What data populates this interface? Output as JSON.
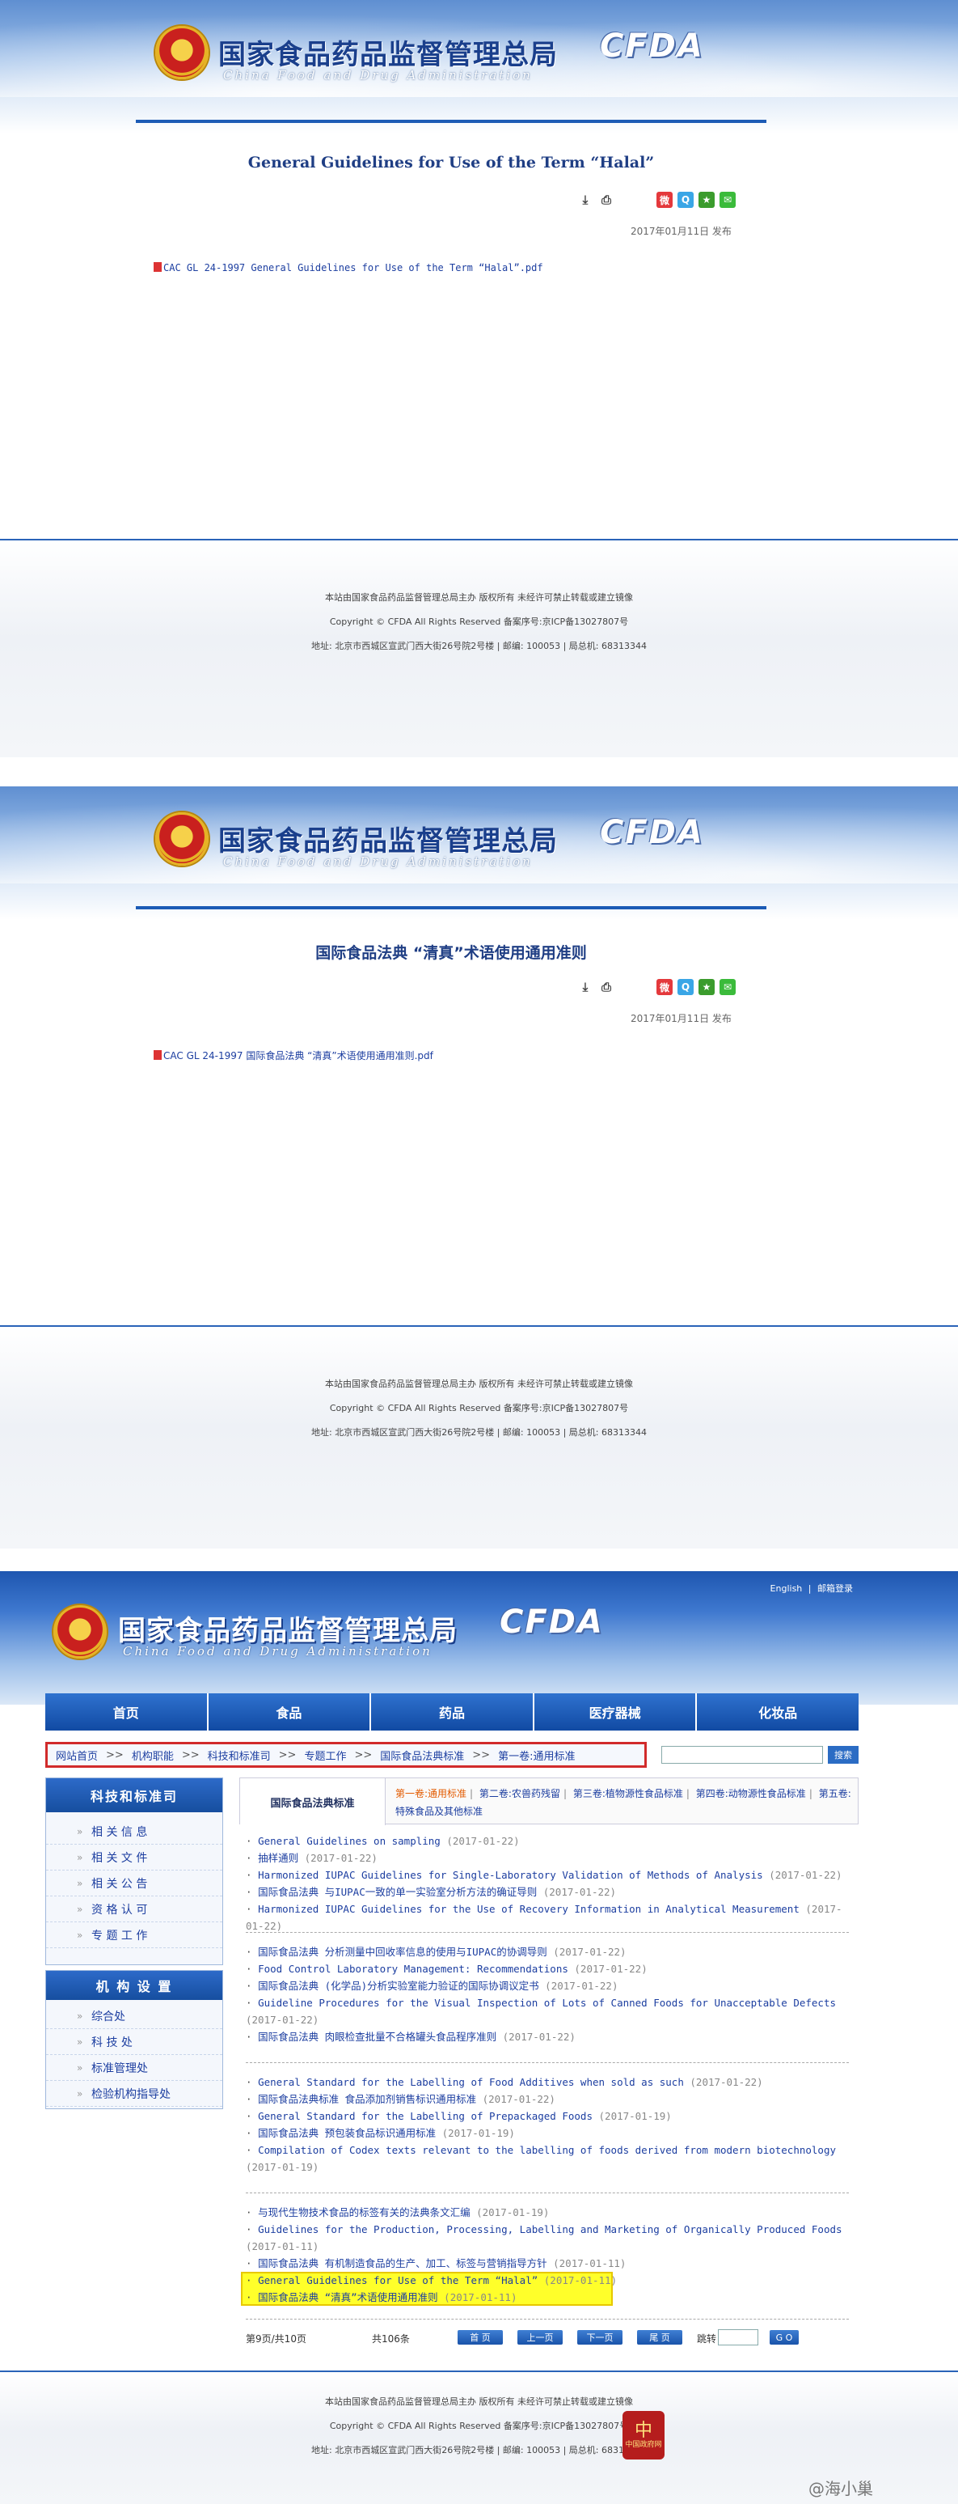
{
  "site": {
    "name_cn": "国家食品药品监督管理总局",
    "name_en": "China Food and Drug Administration",
    "logo_text": "CFDA"
  },
  "articles": [
    {
      "title": "General Guidelines for Use of the Term “Halal”",
      "pub_date": "2017年01月11日 发布",
      "attachment": "CAC GL 24-1997 General Guidelines for Use of the Term “Halal”.pdf"
    },
    {
      "title": "国际食品法典 “清真”术语使用通用准则",
      "pub_date": "2017年01月11日 发布",
      "attachment": "CAC GL 24-1997 国际食品法典 “清真”术语使用通用准则.pdf"
    }
  ],
  "share_icons": [
    "download-icon",
    "print-icon",
    "weibo-icon",
    "qzone-icon",
    "favorite-icon",
    "wechat-icon"
  ],
  "footer": {
    "line1": "本站由国家食品药品监督管理总局主办  版权所有  未经许可禁止转载或建立镜像",
    "line2": "Copyright © CFDA All Rights Reserved  备案序号:京ICP备13027807号",
    "line3": "地址: 北京市西城区宣武门西大街26号院2号楼  |  邮编: 100053  |  局总机: 68313344"
  },
  "top_links": {
    "english": "English",
    "mail": "邮箱登录"
  },
  "nav": [
    "首页",
    "食品",
    "药品",
    "医疗器械",
    "化妆品"
  ],
  "breadcrumb": [
    "网站首页",
    "机构职能",
    "科技和标准司",
    "专题工作",
    "国际食品法典标准",
    "第一卷:通用标准"
  ],
  "breadcrumb_sep": ">>",
  "search": {
    "button": "搜索",
    "placeholder": ""
  },
  "sidebar1": {
    "title": "科技和标准司",
    "items": [
      "相 关 信 息",
      "相 关 文 件",
      "相 关 公 告",
      "资 格 认 可",
      "专 题 工 作"
    ]
  },
  "sidebar2": {
    "title": "机 构 设 置",
    "items": [
      "综合处",
      "科 技 处",
      "标准管理处",
      "检验机构指导处"
    ]
  },
  "tabs": {
    "label": "国际食品法典标准",
    "items": [
      "第一卷:通用标准",
      "第二卷:农兽药残留",
      "第三卷:植物源性食品标准",
      "第四卷:动物源性食品标准",
      "第五卷:特殊食品及其他标准"
    ],
    "active": 0
  },
  "list_groups": [
    [
      {
        "t": "General Guidelines on sampling",
        "d": "(2017-01-22)"
      },
      {
        "t": "抽样通则",
        "d": "(2017-01-22)"
      },
      {
        "t": "Harmonized IUPAC Guidelines for Single-Laboratory Validation of Methods of Analysis",
        "d": "(2017-01-22)"
      },
      {
        "t": "国际食品法典 与IUPAC一致的单一实验室分析方法的确证导则",
        "d": "(2017-01-22)"
      },
      {
        "t": "Harmonized IUPAC Guidelines for the Use of Recovery Information in Analytical Measurement",
        "d": "(2017-01-22)"
      }
    ],
    [
      {
        "t": "国际食品法典 分析测量中回收率信息的使用与IUPAC的协调导则",
        "d": "(2017-01-22)"
      },
      {
        "t": "Food Control Laboratory Management: Recommendations",
        "d": "(2017-01-22)"
      },
      {
        "t": "国际食品法典 (化学品)分析实验室能力验证的国际协调议定书",
        "d": "(2017-01-22)"
      },
      {
        "t": "Guideline Procedures for the Visual Inspection of Lots of Canned Foods for Unacceptable Defects",
        "d": "(2017-01-22)"
      },
      {
        "t": "国际食品法典 肉眼检查批量不合格罐头食品程序准则",
        "d": "(2017-01-22)"
      }
    ],
    [
      {
        "t": "General Standard for the Labelling of Food Additives when sold as such",
        "d": "(2017-01-22)"
      },
      {
        "t": "国际食品法典标准 食品添加剂销售标识通用标准",
        "d": "(2017-01-22)"
      },
      {
        "t": "General Standard for the Labelling of Prepackaged Foods",
        "d": "(2017-01-19)"
      },
      {
        "t": "国际食品法典 预包装食品标识通用标准",
        "d": "(2017-01-19)"
      },
      {
        "t": "Compilation of Codex texts relevant to the labelling of foods derived from modern biotechnology",
        "d": "(2017-01-19)"
      }
    ],
    [
      {
        "t": "与现代生物技术食品的标签有关的法典条文汇编",
        "d": "(2017-01-19)"
      },
      {
        "t": "Guidelines for the Production, Processing, Labelling and Marketing of Organically Produced Foods",
        "d": "(2017-01-11)"
      },
      {
        "t": "国际食品法典 有机制造食品的生产、加工、标签与营销指导方针",
        "d": "(2017-01-11)"
      },
      {
        "t": "General Guidelines for Use of the Term “Halal”",
        "d": "(2017-01-11)"
      },
      {
        "t": "国际食品法典 “清真”术语使用通用准则",
        "d": "(2017-01-11)"
      }
    ]
  ],
  "pager": {
    "page": "第9页/共10页",
    "total": "共106条",
    "first": "首 页",
    "prev": "上一页",
    "next": "下一页",
    "last": "尾 页",
    "jump": "跳转",
    "go": "G O"
  },
  "watermark": "@海小巢",
  "seal_text": "中国政府网"
}
